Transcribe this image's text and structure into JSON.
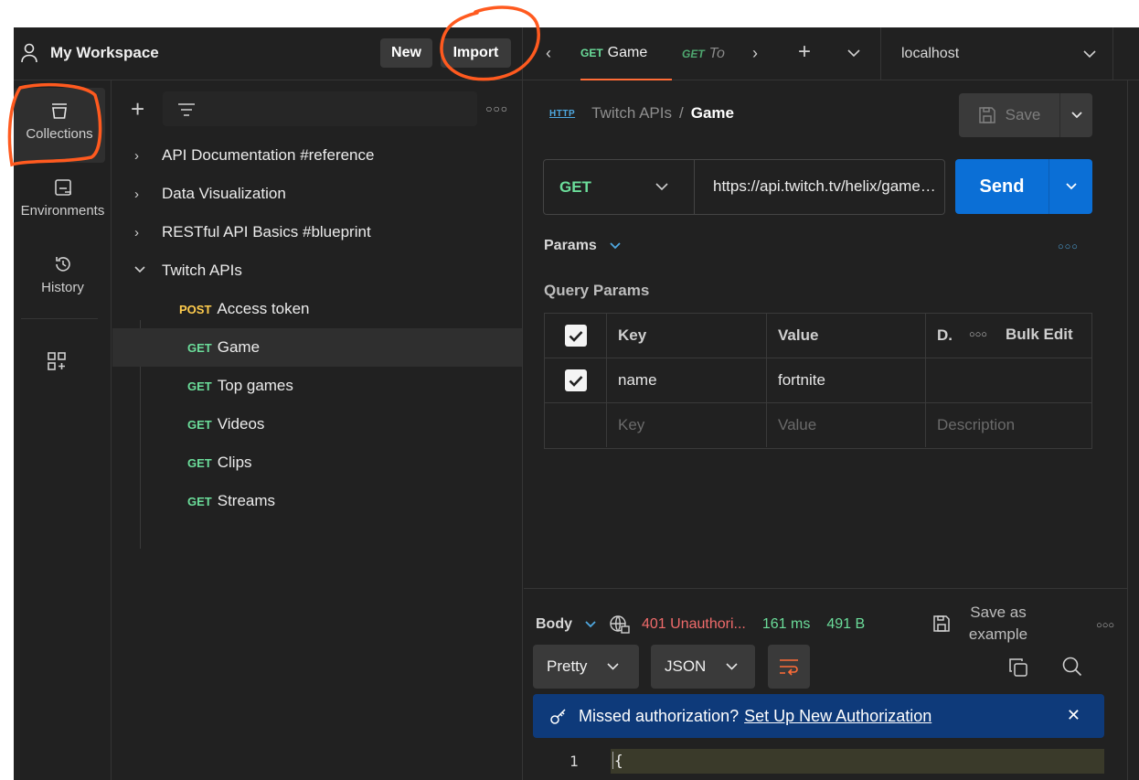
{
  "workspace": {
    "title": "My Workspace",
    "new_label": "New",
    "import_label": "Import"
  },
  "tabs": [
    {
      "method": "GET",
      "title": "Game",
      "active": true
    },
    {
      "method": "GET",
      "title": "To",
      "italic": true
    }
  ],
  "environment": {
    "selected": "localhost"
  },
  "rail": [
    {
      "label": "Collections",
      "icon": "collections-icon",
      "active": true
    },
    {
      "label": "Environments",
      "icon": "environments-icon"
    },
    {
      "label": "History",
      "icon": "history-icon"
    }
  ],
  "sidebar": {
    "collections": [
      {
        "label": "API Documentation #reference",
        "expanded": false
      },
      {
        "label": "Data Visualization",
        "expanded": false
      },
      {
        "label": "RESTful API Basics #blueprint",
        "expanded": false
      },
      {
        "label": "Twitch APIs",
        "expanded": true
      }
    ],
    "requests": [
      {
        "method": "POST",
        "label": "Access token"
      },
      {
        "method": "GET",
        "label": "Game",
        "selected": true
      },
      {
        "method": "GET",
        "label": "Top games"
      },
      {
        "method": "GET",
        "label": "Videos"
      },
      {
        "method": "GET",
        "label": "Clips"
      },
      {
        "method": "GET",
        "label": "Streams"
      }
    ]
  },
  "request": {
    "breadcrumb_icon_text": "HTTP",
    "breadcrumb_parent": "Twitch APIs",
    "breadcrumb_sep": "/",
    "breadcrumb_current": "Game",
    "save_label": "Save",
    "method": "GET",
    "url": "https://api.twitch.tv/helix/games?name=fortnite",
    "send_label": "Send",
    "params_label": "Params",
    "query_params_label": "Query Params",
    "table": {
      "headers": {
        "key": "Key",
        "value": "Value",
        "description": "D.",
        "bulk_edit": "Bulk Edit"
      },
      "rows": [
        {
          "checked": true,
          "key": "name",
          "value": "fortnite",
          "description": ""
        }
      ],
      "placeholders": {
        "key": "Key",
        "value": "Value",
        "description": "Description"
      }
    }
  },
  "response": {
    "body_label": "Body",
    "status": "401 Unauthori...",
    "time": "161 ms",
    "size": "491 B",
    "save_example_line1": "Save as",
    "save_example_line2": "example",
    "format": "Pretty",
    "language": "JSON",
    "banner_text": "Missed authorization?",
    "banner_link": "Set Up New Authorization",
    "line_number": "1",
    "line_text": "{"
  },
  "colors": {
    "accent": "#ff6c37",
    "send": "#0b6fd6",
    "get": "#6bdd9a",
    "post": "#ffcc4d",
    "error": "#f06b6b",
    "banner": "#0e3a7a"
  }
}
